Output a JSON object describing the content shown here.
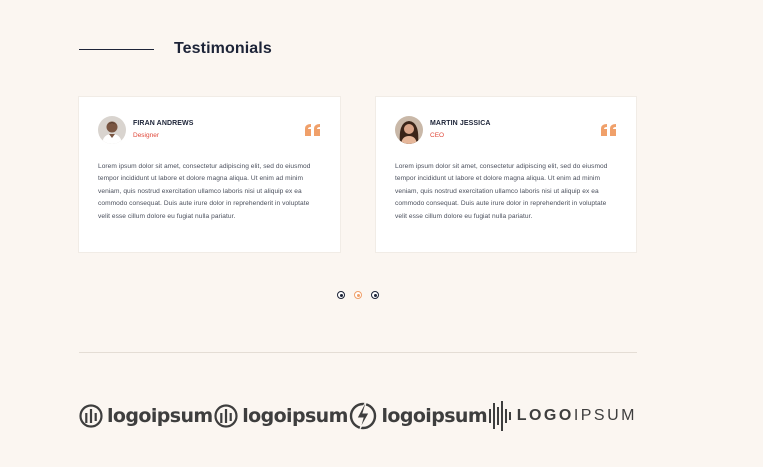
{
  "section": {
    "title": "Testimonials"
  },
  "testimonials": [
    {
      "name": "FIRAN ANDREWS",
      "role": "Designer",
      "text": "Lorem ipsum dolor sit amet, consectetur adipiscing elit, sed do eiusmod tempor incididunt ut labore et dolore magna aliqua. Ut enim ad minim veniam, quis nostrud exercitation ullamco laboris nisi ut aliquip ex ea commodo consequat. Duis aute irure dolor in reprehenderit in voluptate velit esse cillum dolore eu fugiat nulla pariatur."
    },
    {
      "name": "MARTIN JESSICA",
      "role": "CEO",
      "text": "Lorem ipsum dolor sit amet, consectetur adipiscing elit, sed do eiusmod tempor incididunt ut labore et dolore magna aliqua. Ut enim ad minim veniam, quis nostrud exercitation ullamco laboris nisi ut aliquip ex ea commodo consequat. Duis aute irure dolor in reprehenderit in voluptate velit esse cillum dolore eu fugiat nulla pariatur."
    }
  ],
  "carousel": {
    "pages": 3,
    "active": 2
  },
  "logos": [
    {
      "text": "logoipsum",
      "icon": "circle-bars-icon"
    },
    {
      "text": "logoipsum",
      "icon": "circle-bars-icon"
    },
    {
      "text": "logoipsum",
      "icon": "bolt-circle-icon"
    },
    {
      "text_bold": "LOGO",
      "text_light": "IPSUM",
      "icon": "sound-wave-icon"
    }
  ],
  "colors": {
    "background": "#fbf6f1",
    "heading": "#1d2438",
    "role": "#e0483a",
    "quote": "#f0a06a",
    "logo": "#3e3e3e"
  }
}
